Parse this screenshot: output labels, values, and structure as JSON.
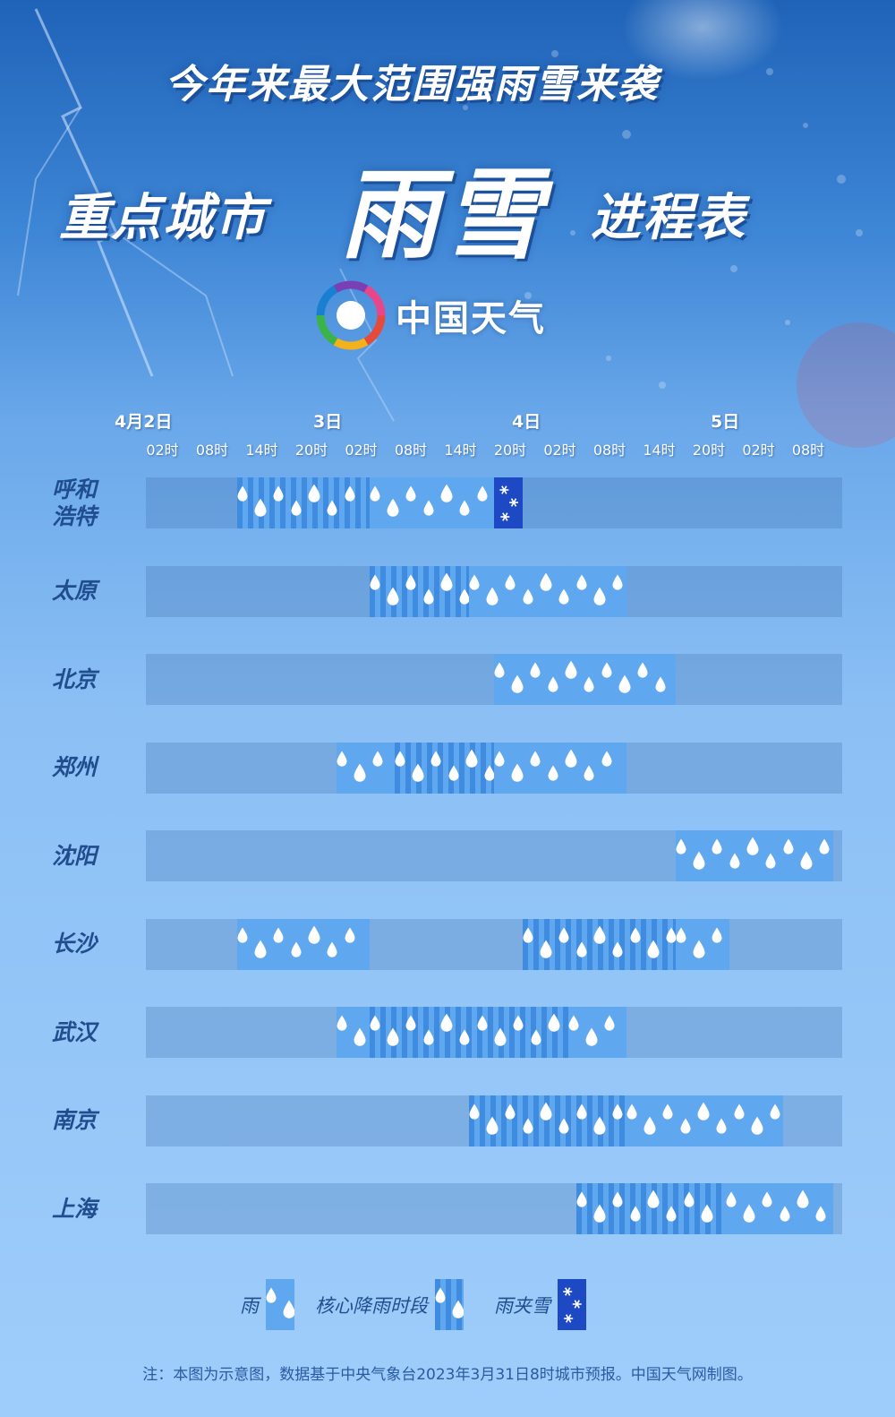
{
  "title_line1": "今年来最大范围强雨雪来袭",
  "title_left": "重点城市",
  "title_big": "雨雪",
  "title_right": "进程表",
  "logo_text": "中国天气",
  "chart_data": {
    "type": "gantt",
    "x_dates": [
      {
        "label": "4月2日",
        "at_hour": 0
      },
      {
        "label": "3日",
        "at_hour": 24
      },
      {
        "label": "4日",
        "at_hour": 48
      },
      {
        "label": "5日",
        "at_hour": 72
      }
    ],
    "x_ticks": [
      "02时",
      "08时",
      "14时",
      "20时",
      "02时",
      "08时",
      "14时",
      "20时",
      "02时",
      "08时",
      "14时",
      "20时",
      "02时",
      "08时"
    ],
    "x_tick_hours": [
      2,
      8,
      14,
      20,
      26,
      32,
      38,
      44,
      50,
      56,
      62,
      68,
      74,
      80
    ],
    "rows": [
      {
        "city": "呼和\n浩特",
        "segments": [
          {
            "start": 11,
            "end": 27,
            "kind": "core"
          },
          {
            "start": 27,
            "end": 42,
            "kind": "rain"
          },
          {
            "start": 42,
            "end": 45.5,
            "kind": "snow"
          }
        ]
      },
      {
        "city": "太原",
        "segments": [
          {
            "start": 27,
            "end": 39,
            "kind": "core"
          },
          {
            "start": 39,
            "end": 58,
            "kind": "rain"
          }
        ]
      },
      {
        "city": "北京",
        "segments": [
          {
            "start": 42,
            "end": 64,
            "kind": "rain"
          }
        ]
      },
      {
        "city": "郑州",
        "segments": [
          {
            "start": 23,
            "end": 30,
            "kind": "rain"
          },
          {
            "start": 30,
            "end": 42,
            "kind": "core"
          },
          {
            "start": 42,
            "end": 58,
            "kind": "rain"
          }
        ]
      },
      {
        "city": "沈阳",
        "segments": [
          {
            "start": 64,
            "end": 83,
            "kind": "rain"
          }
        ]
      },
      {
        "city": "长沙",
        "segments": [
          {
            "start": 11,
            "end": 27,
            "kind": "rain"
          },
          {
            "start": 45.5,
            "end": 64,
            "kind": "core"
          },
          {
            "start": 64,
            "end": 70.5,
            "kind": "rain"
          }
        ]
      },
      {
        "city": "武汉",
        "segments": [
          {
            "start": 23,
            "end": 27,
            "kind": "rain"
          },
          {
            "start": 27,
            "end": 51,
            "kind": "core"
          },
          {
            "start": 51,
            "end": 58,
            "kind": "rain"
          }
        ]
      },
      {
        "city": "南京",
        "segments": [
          {
            "start": 39,
            "end": 58,
            "kind": "core"
          },
          {
            "start": 58,
            "end": 77,
            "kind": "rain"
          }
        ]
      },
      {
        "city": "上海",
        "segments": [
          {
            "start": 52,
            "end": 70,
            "kind": "core"
          },
          {
            "start": 70,
            "end": 83,
            "kind": "rain"
          }
        ]
      }
    ],
    "legend": [
      {
        "label": "雨",
        "kind": "rain"
      },
      {
        "label": "核心降雨时段",
        "kind": "core"
      },
      {
        "label": "雨夹雪",
        "kind": "snow"
      }
    ]
  },
  "footnote": "注：本图为示意图，数据基于中央气象台2023年3月31日8时城市预报。中国天气网制图。",
  "colors": {
    "rain": "#5fa8f0",
    "core_stripe": "#3f8be0",
    "snow": "#1e49c4",
    "city_text": "#1f4d8e"
  }
}
